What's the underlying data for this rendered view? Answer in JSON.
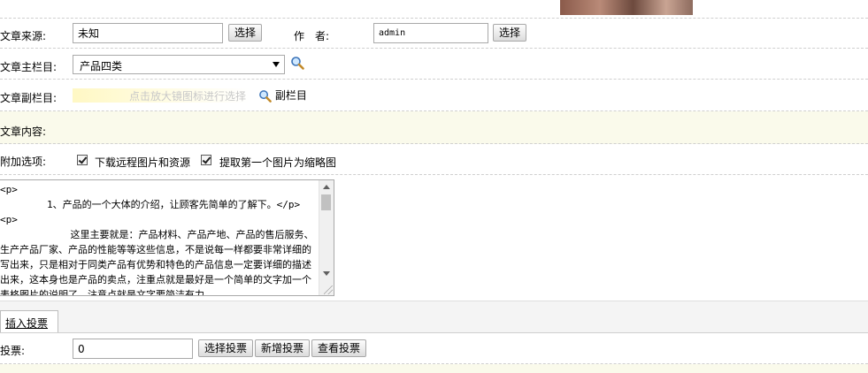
{
  "form": {
    "source_label": "文章来源:",
    "source_value": "未知",
    "source_select_button": "选择",
    "author_label": "作　者:",
    "author_value": "admin",
    "author_select_button": "选择",
    "main_column_label": "文章主栏目:",
    "main_column_selected": "产品四类",
    "sub_column_label": "文章副栏目:",
    "sub_column_hint": "点击放大镜图标进行选择",
    "sub_column_link": "副栏目",
    "content_label": "文章内容:",
    "options_label": "附加选项:",
    "option_download_remote": "下载远程图片和资源",
    "option_first_image_thumb": "提取第一个图片为缩略图",
    "download_remote_checked": true,
    "first_image_thumb_checked": true,
    "editor_content": "<p>\n        1、产品的一个大体的介绍，让顾客先简单的了解下。</p>\n<p>\n            这里主要就是：产品材料、产品产地、产品的售后服务、生产产品厂家、产品的性能等等这些信息，不是说每一样都要非常详细的写出来，只是相对于同类产品有优势和特色的产品信息一定要详细的描述出来，这本身也是产品的卖点，注重点就是最好是一个简单的文字加一个表格图片的说明了。注意点就是文字要简洁有力，",
    "vote_tab": "插入投票",
    "vote_label": "投票:",
    "vote_value": "0",
    "vote_select_button": "选择投票",
    "vote_add_button": "新增投票",
    "vote_view_button": "查看投票"
  },
  "colors": {
    "highlight_row": "#fafaeb",
    "hint_field": "#fff8c4",
    "hint_text": "#c8c8c8"
  },
  "icons": {
    "main_column_search": "magnifier-icon",
    "sub_column_search": "magnifier-icon"
  }
}
